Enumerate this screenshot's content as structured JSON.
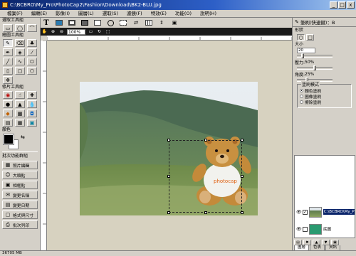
{
  "window": {
    "title": "C:\\BCBRO\\My_Pro\\PhotoCap2\\Fashion\\Download\\BK2-BLU.jpg",
    "buttons": [
      "_",
      "□",
      "x"
    ]
  },
  "menu": [
    "檔案(F)",
    "編輯(E)",
    "影像(I)",
    "圖層(L)",
    "選取(S)",
    "濾鏡(F)",
    "特效(E)",
    "功能(O)",
    "說明(H)"
  ],
  "toolbar1": {
    "text_tool": "T",
    "icons": [
      "image-icon",
      "frame-icon",
      "film-icon",
      "textbox-icon",
      "circle-icon",
      "cut-icon",
      "flip-icon",
      "grid-icon",
      "arrows-icon",
      "puzzle-icon"
    ]
  },
  "toolbar2": {
    "zoom_value": "100%",
    "icons": [
      "hand-icon",
      "zoom-in-icon",
      "zoom-out-icon",
      "fit-icon",
      "rotate-icon",
      "select-icon"
    ]
  },
  "left_panel": {
    "section1_title": "選取工具組",
    "section2_title": "繪圖工具組",
    "section3_title": "修片工具組",
    "color_title": "顏色",
    "section4_title": "批次功能群組",
    "big_buttons": [
      "照片編輯",
      "大頭貼",
      "相框貼",
      "批次處理",
      "批次列印",
      "相片名片",
      "名片製作",
      "製作月曆"
    ],
    "batch_buttons": [
      "照片編輯",
      "大頭貼",
      "相框貼"
    ],
    "action_buttons": [
      "變更名稱",
      "變更日期",
      "格式與尺寸",
      "批次列印"
    ],
    "foreground_color": "#000000",
    "background_color": "#ffffff"
  },
  "right_panel": {
    "title": "筆刷(快速鍵)：B",
    "shape_label": "形狀",
    "size_label": "大小",
    "size_value": "20",
    "pressure_label": "壓力:",
    "pressure_value": "50%",
    "angle_label": "角度:",
    "angle_value": "25%",
    "pressure_fraction": 0.5,
    "angle_fraction": 0.25,
    "mode_legend": "塗刷模式",
    "mode_options": [
      "顏色塗刷",
      "圖像塗刷",
      "擦除塗刷"
    ],
    "mode_selected": 0,
    "layers": [
      {
        "name": "C:\\BCBRO\\My_P",
        "selected": true
      },
      {
        "name": "底圖",
        "selected": false
      }
    ],
    "tabs": [
      "圖層",
      "色表",
      "資訊"
    ],
    "active_tab": 0
  },
  "status": {
    "memory": "36705 MB"
  },
  "colors": {
    "title_start": "#0a246a",
    "title_end": "#a6caf0",
    "canvas_bg": "#d7d2c0",
    "selection": "#0a246a"
  }
}
